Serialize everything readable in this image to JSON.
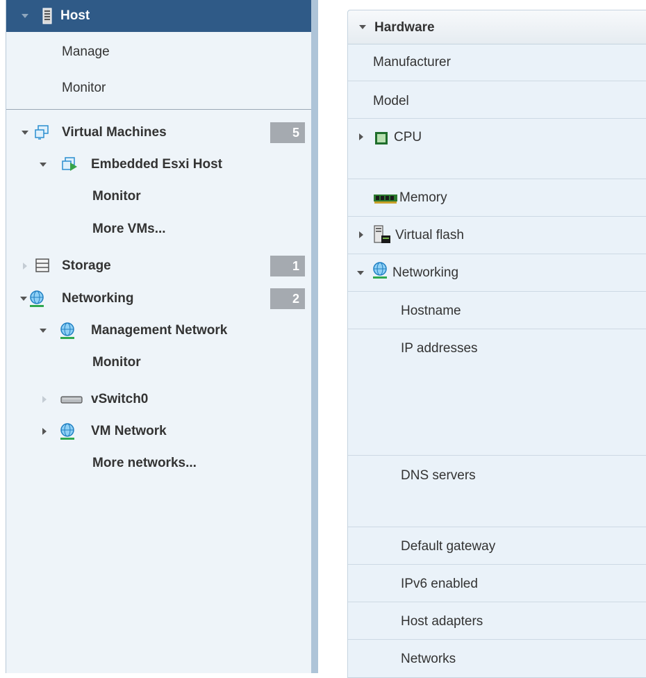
{
  "navigator": {
    "host": {
      "label": "Host"
    },
    "host_children": [
      {
        "label": "Manage"
      },
      {
        "label": "Monitor"
      }
    ],
    "virtual_machines": {
      "label": "Virtual Machines",
      "count": "5",
      "host_item": {
        "label": "Embedded Esxi Host"
      },
      "children": [
        {
          "label": "Monitor"
        },
        {
          "label": "More VMs..."
        }
      ]
    },
    "storage": {
      "label": "Storage",
      "count": "1"
    },
    "networking": {
      "label": "Networking",
      "count": "2",
      "management_network": {
        "label": "Management Network"
      },
      "management_children": [
        {
          "label": "Monitor"
        }
      ],
      "vswitch": {
        "label": "vSwitch0"
      },
      "vm_network": {
        "label": "VM Network"
      },
      "more": {
        "label": "More networks..."
      }
    }
  },
  "hardware": {
    "title": "Hardware",
    "rows": [
      {
        "label": "Manufacturer"
      },
      {
        "label": "Model"
      },
      {
        "label": "CPU"
      },
      {
        "label": "Memory"
      },
      {
        "label": "Virtual flash"
      },
      {
        "label": "Networking"
      },
      {
        "label": "Hostname"
      },
      {
        "label": "IP addresses"
      },
      {
        "label": "DNS servers"
      },
      {
        "label": "Default gateway"
      },
      {
        "label": "IPv6 enabled"
      },
      {
        "label": "Host adapters"
      },
      {
        "label": "Networks"
      }
    ]
  },
  "icons": {
    "host": "server-icon",
    "virtual_machines": "virtual-machines-icon",
    "vm": "vm-icon",
    "storage": "storage-icon",
    "networking": "network-globe-icon",
    "vswitch": "vswitch-icon",
    "cpu": "cpu-icon",
    "memory": "memory-icon",
    "virtual_flash": "virtual-flash-icon"
  },
  "colors": {
    "header_bg": "#2f5a87",
    "navigator_bg": "#eef4f9",
    "panel_bg": "#eaf2f9",
    "count_badge": "#a5aab0",
    "divider_bar": "#aec4d8"
  }
}
